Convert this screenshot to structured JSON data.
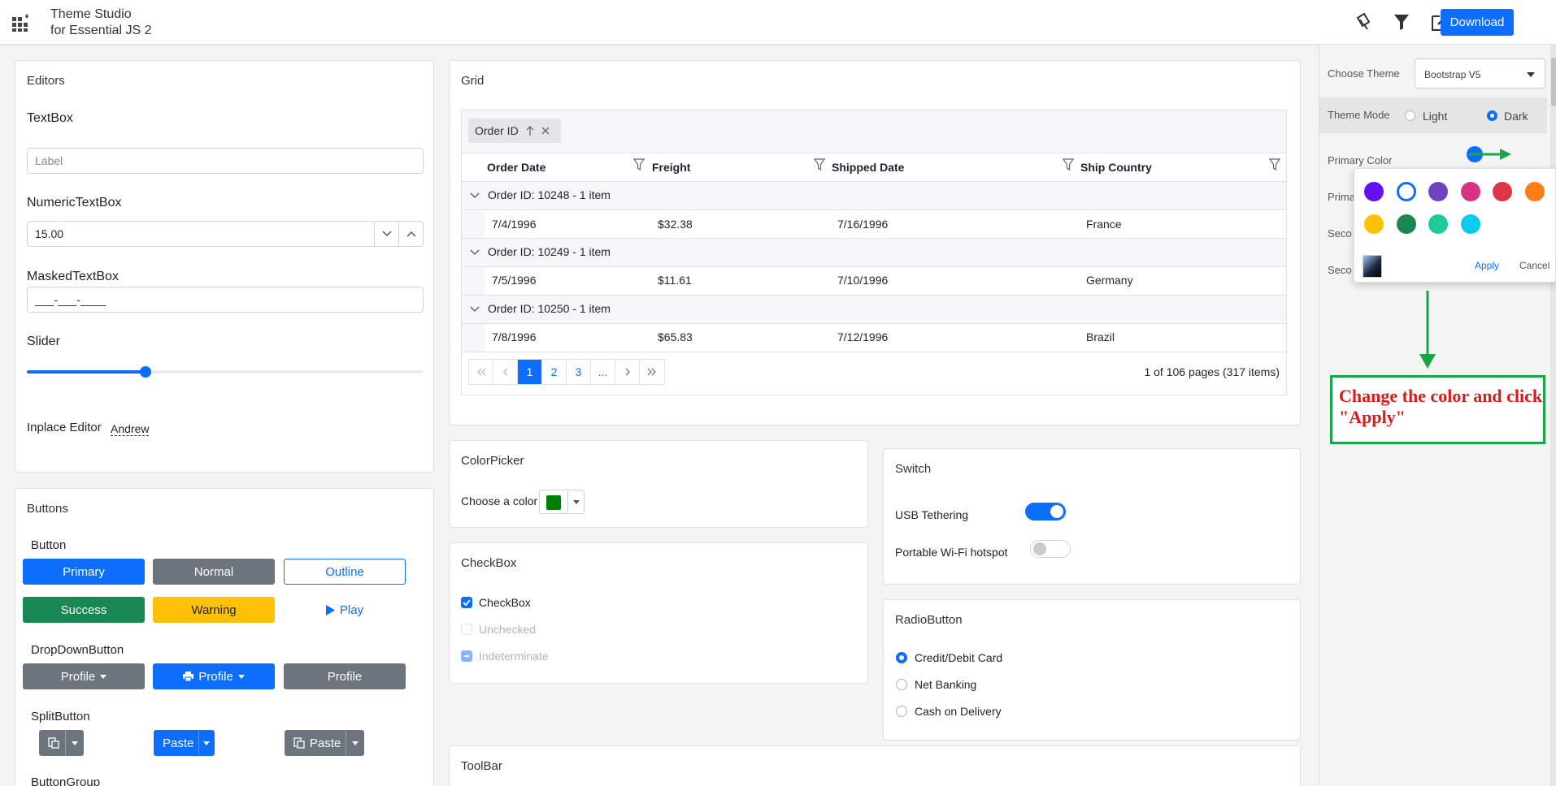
{
  "header": {
    "brand_line1": "Theme Studio",
    "brand_line2": "for Essential JS 2",
    "download_label": "Download"
  },
  "editors": {
    "title": "Editors",
    "textbox_label": "TextBox",
    "textbox_placeholder": "Label",
    "numeric_label": "NumericTextBox",
    "numeric_value": "15.00",
    "masked_label": "MaskedTextBox",
    "masked_value": "___-___-____",
    "slider_label": "Slider",
    "slider_value": 0.3,
    "inplace_label": "Inplace Editor",
    "inplace_value": "Andrew"
  },
  "buttons": {
    "title": "Buttons",
    "button_label": "Button",
    "primary": "Primary",
    "normal": "Normal",
    "outline": "Outline",
    "success": "Success",
    "warning": "Warning",
    "play": "Play",
    "dropdown_label": "DropDownButton",
    "profile": "Profile",
    "split_label": "SplitButton",
    "paste": "Paste",
    "group_label": "ButtonGroup"
  },
  "grid": {
    "title": "Grid",
    "group_chip": "Order ID",
    "columns": [
      "Order Date",
      "Freight",
      "Shipped Date",
      "Ship Country"
    ],
    "groups": [
      {
        "caption": "Order ID: 10248 - 1 item",
        "row": [
          "7/4/1996",
          "$32.38",
          "7/16/1996",
          "France"
        ]
      },
      {
        "caption": "Order ID: 10249 - 1 item",
        "row": [
          "7/5/1996",
          "$11.61",
          "7/10/1996",
          "Germany"
        ]
      },
      {
        "caption": "Order ID: 10250 - 1 item",
        "row": [
          "7/8/1996",
          "$65.83",
          "7/12/1996",
          "Brazil"
        ]
      }
    ],
    "pager": {
      "pages": [
        "1",
        "2",
        "3",
        "..."
      ],
      "info": "1 of 106 pages (317 items)"
    }
  },
  "colorpicker": {
    "title": "ColorPicker",
    "label": "Choose a color",
    "value_color": "#008000"
  },
  "checkbox": {
    "title": "CheckBox",
    "items": [
      "CheckBox",
      "Unchecked",
      "Indeterminate"
    ]
  },
  "switch": {
    "title": "Switch",
    "items": [
      "USB Tethering",
      "Portable Wi-Fi hotspot"
    ]
  },
  "radio": {
    "title": "RadioButton",
    "items": [
      "Credit/Debit Card",
      "Net Banking",
      "Cash on Delivery"
    ]
  },
  "toolbar": {
    "title": "ToolBar"
  },
  "panel": {
    "choose_theme_label": "Choose Theme",
    "theme_value": "Bootstrap V5",
    "theme_mode_label": "Theme Mode",
    "mode_light": "Light",
    "mode_dark": "Dark",
    "primary_color_label": "Primary Color",
    "row2_label": "Prima",
    "row3_label": "Seco",
    "row4_label": "Seco",
    "primary_color": "#0d6efd"
  },
  "palette": {
    "apply": "Apply",
    "cancel": "Cancel",
    "colors": [
      "#6610f2",
      "#ffffff",
      "#6f42c1",
      "#d63384",
      "#dc3545",
      "#fd7e14",
      "#ffc107",
      "#198754",
      "#20c997",
      "#0dcaf0"
    ]
  },
  "callout": {
    "text": "Change the color and click \"Apply\""
  }
}
